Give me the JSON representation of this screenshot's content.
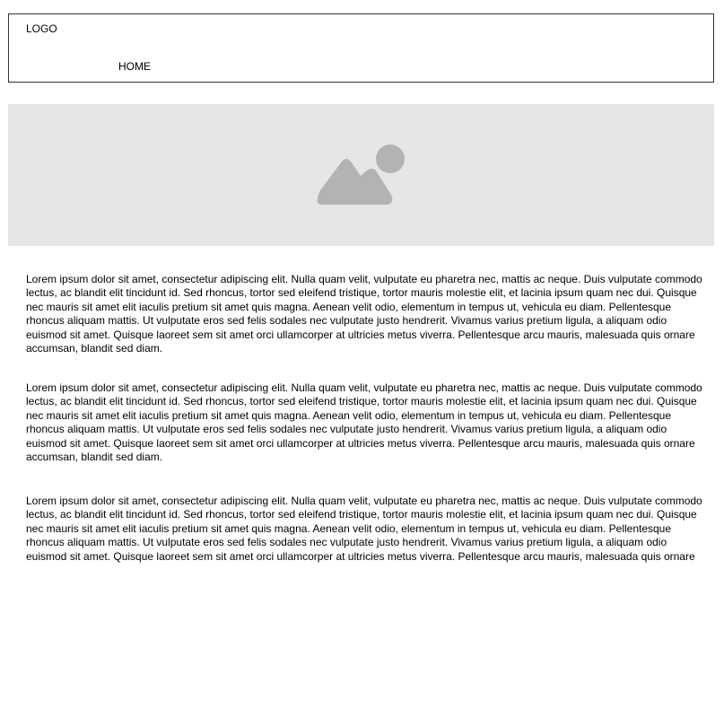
{
  "header": {
    "logo_text": "LOGO",
    "nav": [
      {
        "label": "HOME"
      }
    ]
  },
  "hero": {
    "icon": "image-placeholder-icon",
    "background": "#e6e6e6",
    "icon_color": "#b3b3b3"
  },
  "content": {
    "paragraphs": [
      "Lorem ipsum dolor sit amet, consectetur adipiscing elit. Nulla quam velit, vulputate eu pharetra nec, mattis ac neque. Duis vulputate commodo lectus, ac blandit elit tincidunt id. Sed rhoncus, tortor sed eleifend tristique, tortor mauris molestie elit, et lacinia ipsum quam nec dui. Quisque nec mauris sit amet elit iaculis pretium sit amet quis magna. Aenean velit odio, elementum in tempus ut, vehicula eu diam. Pellentesque rhoncus aliquam mattis. Ut vulputate eros sed felis sodales nec vulputate justo hendrerit. Vivamus varius pretium ligula, a aliquam odio euismod sit amet. Quisque laoreet sem sit amet orci ullamcorper at ultricies metus viverra. Pellentesque arcu mauris, malesuada quis ornare accumsan, blandit sed diam.",
      "Lorem ipsum dolor sit amet, consectetur adipiscing elit. Nulla quam velit, vulputate eu pharetra nec, mattis ac neque. Duis vulputate commodo lectus, ac blandit elit tincidunt id. Sed rhoncus, tortor sed eleifend tristique, tortor mauris molestie elit, et lacinia ipsum quam nec dui. Quisque nec mauris sit amet elit iaculis pretium sit amet quis magna. Aenean velit odio, elementum in tempus ut, vehicula eu diam. Pellentesque rhoncus aliquam mattis. Ut vulputate eros sed felis sodales nec vulputate justo hendrerit. Vivamus varius pretium ligula, a aliquam odio euismod sit amet. Quisque laoreet sem sit amet orci ullamcorper at ultricies metus viverra. Pellentesque arcu mauris, malesuada quis ornare accumsan, blandit sed diam.",
      "Lorem ipsum dolor sit amet, consectetur adipiscing elit. Nulla quam velit, vulputate eu pharetra nec, mattis ac neque. Duis vulputate commodo lectus, ac blandit elit tincidunt id. Sed rhoncus, tortor sed eleifend tristique, tortor mauris molestie elit, et lacinia ipsum quam nec dui. Quisque nec mauris sit amet elit iaculis pretium sit amet quis magna. Aenean velit odio, elementum in tempus ut, vehicula eu diam. Pellentesque rhoncus aliquam mattis. Ut vulputate eros sed felis sodales nec vulputate justo hendrerit. Vivamus varius pretium ligula, a aliquam odio euismod sit amet. Quisque laoreet sem sit amet orci ullamcorper at ultricies metus viverra. Pellentesque arcu mauris, malesuada quis ornare accumsan, blandit sed"
    ]
  }
}
